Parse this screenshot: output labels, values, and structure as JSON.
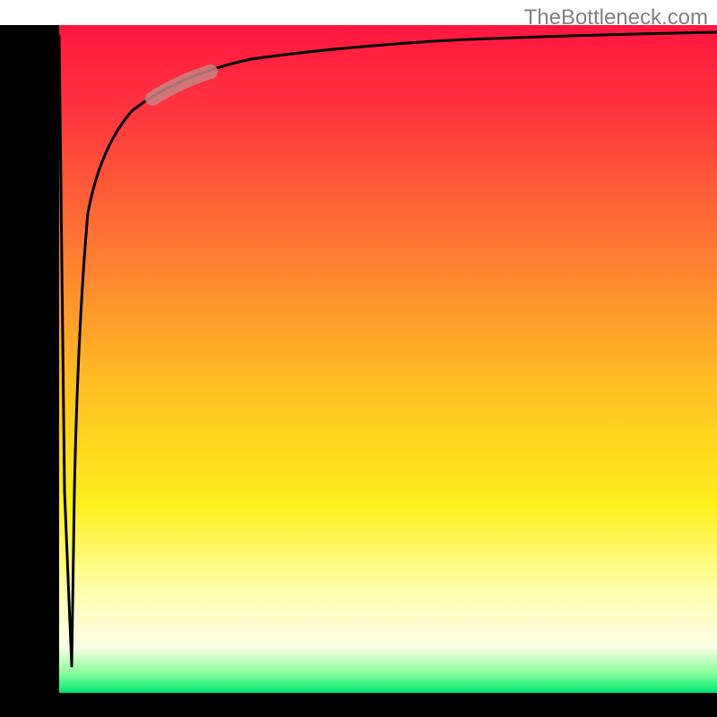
{
  "watermark": "TheBottleneck.com",
  "chart_data": {
    "type": "line",
    "title": "",
    "xlabel": "",
    "ylabel": "",
    "xlim": [
      0,
      100
    ],
    "ylim": [
      0,
      100
    ],
    "axes_left_bar": {
      "x_fraction": 0.04,
      "width_fraction": 0.045
    },
    "axes_bottom_bar": {
      "y_fraction": 0.965,
      "height_fraction": 0.03
    },
    "background_gradient": {
      "type": "vertical",
      "stops": [
        {
          "pos": 0.0,
          "color": "#ff163f"
        },
        {
          "pos": 0.15,
          "color": "#ff3b3d"
        },
        {
          "pos": 0.35,
          "color": "#ff7f32"
        },
        {
          "pos": 0.55,
          "color": "#ffc222"
        },
        {
          "pos": 0.72,
          "color": "#fff01e"
        },
        {
          "pos": 0.85,
          "color": "#ffffb0"
        },
        {
          "pos": 0.93,
          "color": "#ffffe8"
        },
        {
          "pos": 0.97,
          "color": "#8cff9c"
        },
        {
          "pos": 1.0,
          "color": "#00e673"
        }
      ]
    },
    "curve": {
      "description": "Steep rise from bottom-left then asymptotic toward top",
      "points": [
        {
          "x": 6.2,
          "y": 4
        },
        {
          "x": 6.6,
          "y": 30
        },
        {
          "x": 7.2,
          "y": 55
        },
        {
          "x": 8.5,
          "y": 72
        },
        {
          "x": 11,
          "y": 82
        },
        {
          "x": 15,
          "y": 87.5
        },
        {
          "x": 22,
          "y": 91
        },
        {
          "x": 35,
          "y": 93.5
        },
        {
          "x": 55,
          "y": 95.3
        },
        {
          "x": 78,
          "y": 96.3
        },
        {
          "x": 100,
          "y": 96.8
        }
      ]
    },
    "marker_segment": {
      "description": "Short rounded highlight stroke on the curve",
      "center": {
        "x": 20,
        "y": 90
      },
      "length_fraction": 0.07,
      "color": "#c98383",
      "opacity": 0.85
    }
  }
}
